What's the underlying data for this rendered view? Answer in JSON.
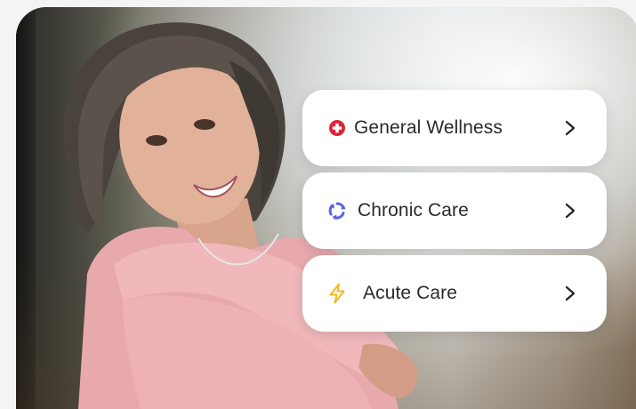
{
  "menu": {
    "items": [
      {
        "label": "General Wellness",
        "icon": "medical-cross-icon",
        "color": "#e0243a"
      },
      {
        "label": "Chronic Care",
        "icon": "recycle-cycle-icon",
        "color": "#5b63e6"
      },
      {
        "label": "Acute Care",
        "icon": "lightning-bolt-icon",
        "color": "#f5b81f"
      }
    ],
    "chevron": "chevron-right-icon"
  },
  "colors": {
    "card_background": "#ffffff",
    "text": "#2b2b2b"
  }
}
